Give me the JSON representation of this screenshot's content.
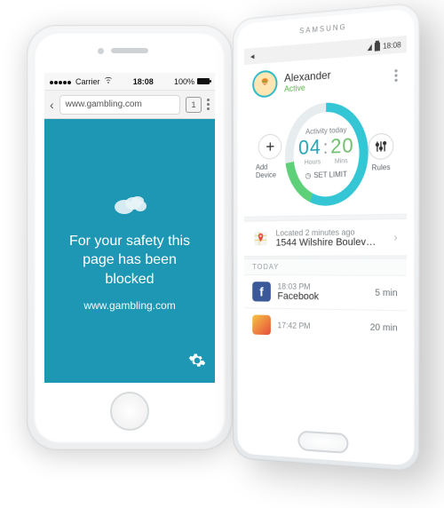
{
  "left": {
    "status": {
      "carrier": "Carrier",
      "wifi_icon": "wifi",
      "time": "18:08",
      "battery_pct": "100%"
    },
    "nav": {
      "url": "www.gambling.com",
      "tab_count": "1"
    },
    "blocked": {
      "headline": "For your safety this page has been blocked",
      "site": "www.gambling.com"
    }
  },
  "right": {
    "brand": "SAMSUNG",
    "status": {
      "time": "18:08"
    },
    "profile": {
      "name": "Alexander",
      "state": "Active"
    },
    "activity": {
      "label": "Activity today",
      "hours": "04",
      "mins": "20",
      "hours_unit": "Hours",
      "mins_unit": "Mins",
      "set_limit": "SET LIMIT"
    },
    "side": {
      "add": "Add Device",
      "rules": "Rules"
    },
    "location": {
      "ago": "Located 2 minutes ago",
      "address": "1544 Wilshire Boulevard..."
    },
    "today_header": "TODAY",
    "apps": [
      {
        "time": "18:03 PM",
        "name": "Facebook",
        "duration": "5 min"
      },
      {
        "time": "17:42 PM",
        "name": "",
        "duration": "20 min"
      }
    ]
  }
}
